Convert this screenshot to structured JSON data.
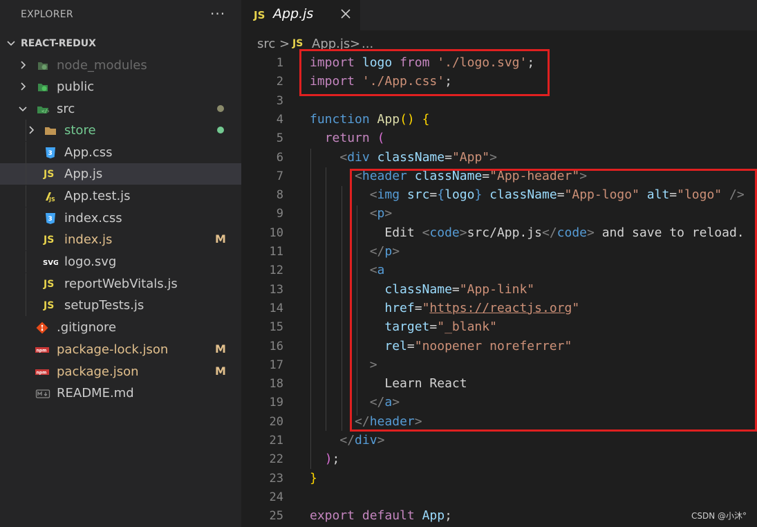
{
  "explorer": {
    "title": "EXPLORER",
    "more": "···",
    "project": "REACT-REDUX",
    "items": [
      {
        "label": "node_modules",
        "kind": "folder",
        "color": "#6b6b6b"
      },
      {
        "label": "public",
        "kind": "folder",
        "color": "#cccccc"
      },
      {
        "label": "src",
        "kind": "folder",
        "color": "#cccccc"
      },
      {
        "label": "store",
        "kind": "folder",
        "color": "#73c991"
      },
      {
        "label": "App.css",
        "kind": "css",
        "color": "#cccccc"
      },
      {
        "label": "App.js",
        "kind": "js",
        "color": "#cccccc"
      },
      {
        "label": "App.test.js",
        "kind": "test",
        "color": "#cccccc"
      },
      {
        "label": "index.css",
        "kind": "css",
        "color": "#cccccc"
      },
      {
        "label": "index.js",
        "kind": "js",
        "color": "#e2c08d",
        "badge": "M"
      },
      {
        "label": "logo.svg",
        "kind": "svg",
        "color": "#cccccc"
      },
      {
        "label": "reportWebVitals.js",
        "kind": "js",
        "color": "#cccccc"
      },
      {
        "label": "setupTests.js",
        "kind": "js",
        "color": "#cccccc"
      },
      {
        "label": ".gitignore",
        "kind": "git",
        "color": "#cccccc"
      },
      {
        "label": "package-lock.json",
        "kind": "npm",
        "color": "#e2c08d",
        "badge": "M"
      },
      {
        "label": "package.json",
        "kind": "npm",
        "color": "#e2c08d",
        "badge": "M"
      },
      {
        "label": "README.md",
        "kind": "md",
        "color": "#cccccc"
      }
    ]
  },
  "tab": {
    "icon": "JS",
    "label": "App.js"
  },
  "breadcrumb": {
    "part1": "src",
    "sep": ">",
    "icon": "JS",
    "part2": "App.js",
    "sep2": ">",
    "part3": "..."
  },
  "editor": {
    "line_numbers": [
      "1",
      "2",
      "3",
      "4",
      "5",
      "6",
      "7",
      "8",
      "9",
      "10",
      "11",
      "12",
      "13",
      "14",
      "15",
      "16",
      "17",
      "18",
      "19",
      "20",
      "21",
      "22",
      "23",
      "24",
      "25"
    ]
  },
  "watermark": "CSDN @小沐°",
  "colors": {
    "highlight": "#e02020",
    "modified": "#e2c08d",
    "untracked": "#73c991"
  }
}
